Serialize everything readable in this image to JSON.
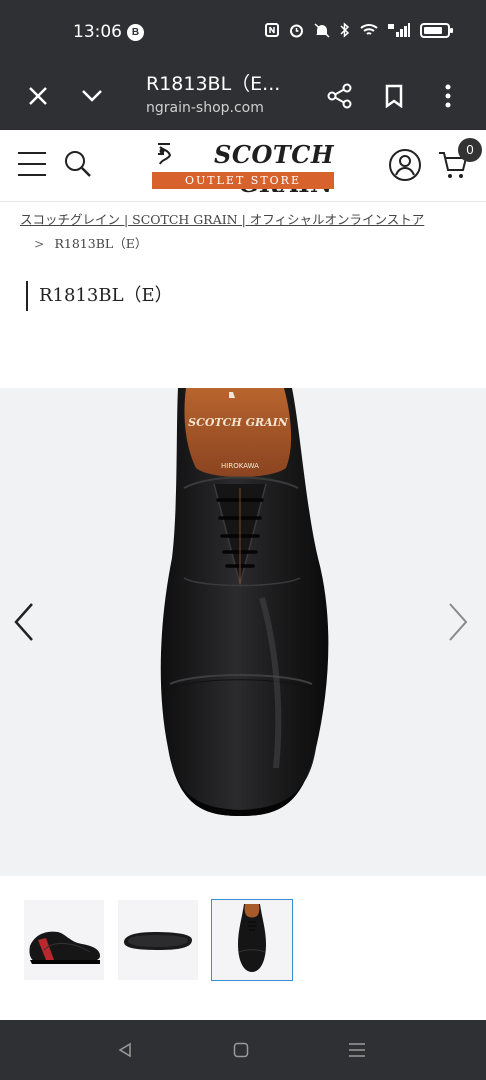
{
  "status_bar": {
    "time": "13:06",
    "notification_badge": "B"
  },
  "browser": {
    "tab_title": "R1813BL（E...",
    "url": "ngrain-shop.com"
  },
  "site": {
    "brand_name": "SCOTCH GRAIN",
    "brand_sub": "OUTLET STORE",
    "cart_count": "0",
    "accent_color": "#d8622c"
  },
  "breadcrumb": {
    "home_label": "スコッチグレイン | SCOTCH GRAIN | オフィシャルオンラインストア",
    "separator": ">",
    "current": "R1813BL（E）"
  },
  "product": {
    "title": "R1813BL（E）",
    "insole_brand": "SCOTCH GRAIN",
    "insole_maker": "HIROKAWA"
  },
  "gallery": {
    "thumbnails": [
      {
        "icon": "shoe-side-thumbnail"
      },
      {
        "icon": "shoe-sole-thumbnail"
      },
      {
        "icon": "shoe-top-thumbnail"
      }
    ],
    "active_index": 3
  }
}
